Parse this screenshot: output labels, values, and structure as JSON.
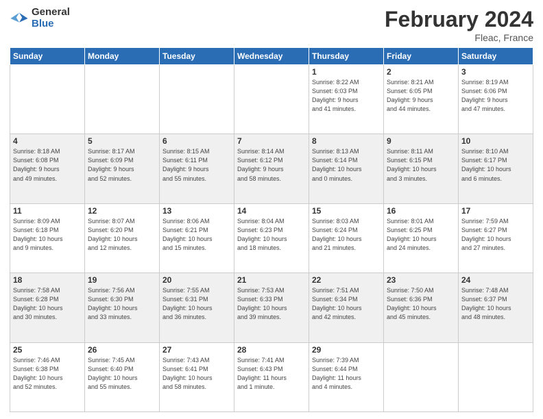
{
  "header": {
    "logo_general": "General",
    "logo_blue": "Blue",
    "title": "February 2024",
    "location": "Fleac, France"
  },
  "days_of_week": [
    "Sunday",
    "Monday",
    "Tuesday",
    "Wednesday",
    "Thursday",
    "Friday",
    "Saturday"
  ],
  "weeks": [
    [
      {
        "num": "",
        "info": ""
      },
      {
        "num": "",
        "info": ""
      },
      {
        "num": "",
        "info": ""
      },
      {
        "num": "",
        "info": ""
      },
      {
        "num": "1",
        "info": "Sunrise: 8:22 AM\nSunset: 6:03 PM\nDaylight: 9 hours\nand 41 minutes."
      },
      {
        "num": "2",
        "info": "Sunrise: 8:21 AM\nSunset: 6:05 PM\nDaylight: 9 hours\nand 44 minutes."
      },
      {
        "num": "3",
        "info": "Sunrise: 8:19 AM\nSunset: 6:06 PM\nDaylight: 9 hours\nand 47 minutes."
      }
    ],
    [
      {
        "num": "4",
        "info": "Sunrise: 8:18 AM\nSunset: 6:08 PM\nDaylight: 9 hours\nand 49 minutes."
      },
      {
        "num": "5",
        "info": "Sunrise: 8:17 AM\nSunset: 6:09 PM\nDaylight: 9 hours\nand 52 minutes."
      },
      {
        "num": "6",
        "info": "Sunrise: 8:15 AM\nSunset: 6:11 PM\nDaylight: 9 hours\nand 55 minutes."
      },
      {
        "num": "7",
        "info": "Sunrise: 8:14 AM\nSunset: 6:12 PM\nDaylight: 9 hours\nand 58 minutes."
      },
      {
        "num": "8",
        "info": "Sunrise: 8:13 AM\nSunset: 6:14 PM\nDaylight: 10 hours\nand 0 minutes."
      },
      {
        "num": "9",
        "info": "Sunrise: 8:11 AM\nSunset: 6:15 PM\nDaylight: 10 hours\nand 3 minutes."
      },
      {
        "num": "10",
        "info": "Sunrise: 8:10 AM\nSunset: 6:17 PM\nDaylight: 10 hours\nand 6 minutes."
      }
    ],
    [
      {
        "num": "11",
        "info": "Sunrise: 8:09 AM\nSunset: 6:18 PM\nDaylight: 10 hours\nand 9 minutes."
      },
      {
        "num": "12",
        "info": "Sunrise: 8:07 AM\nSunset: 6:20 PM\nDaylight: 10 hours\nand 12 minutes."
      },
      {
        "num": "13",
        "info": "Sunrise: 8:06 AM\nSunset: 6:21 PM\nDaylight: 10 hours\nand 15 minutes."
      },
      {
        "num": "14",
        "info": "Sunrise: 8:04 AM\nSunset: 6:23 PM\nDaylight: 10 hours\nand 18 minutes."
      },
      {
        "num": "15",
        "info": "Sunrise: 8:03 AM\nSunset: 6:24 PM\nDaylight: 10 hours\nand 21 minutes."
      },
      {
        "num": "16",
        "info": "Sunrise: 8:01 AM\nSunset: 6:25 PM\nDaylight: 10 hours\nand 24 minutes."
      },
      {
        "num": "17",
        "info": "Sunrise: 7:59 AM\nSunset: 6:27 PM\nDaylight: 10 hours\nand 27 minutes."
      }
    ],
    [
      {
        "num": "18",
        "info": "Sunrise: 7:58 AM\nSunset: 6:28 PM\nDaylight: 10 hours\nand 30 minutes."
      },
      {
        "num": "19",
        "info": "Sunrise: 7:56 AM\nSunset: 6:30 PM\nDaylight: 10 hours\nand 33 minutes."
      },
      {
        "num": "20",
        "info": "Sunrise: 7:55 AM\nSunset: 6:31 PM\nDaylight: 10 hours\nand 36 minutes."
      },
      {
        "num": "21",
        "info": "Sunrise: 7:53 AM\nSunset: 6:33 PM\nDaylight: 10 hours\nand 39 minutes."
      },
      {
        "num": "22",
        "info": "Sunrise: 7:51 AM\nSunset: 6:34 PM\nDaylight: 10 hours\nand 42 minutes."
      },
      {
        "num": "23",
        "info": "Sunrise: 7:50 AM\nSunset: 6:36 PM\nDaylight: 10 hours\nand 45 minutes."
      },
      {
        "num": "24",
        "info": "Sunrise: 7:48 AM\nSunset: 6:37 PM\nDaylight: 10 hours\nand 48 minutes."
      }
    ],
    [
      {
        "num": "25",
        "info": "Sunrise: 7:46 AM\nSunset: 6:38 PM\nDaylight: 10 hours\nand 52 minutes."
      },
      {
        "num": "26",
        "info": "Sunrise: 7:45 AM\nSunset: 6:40 PM\nDaylight: 10 hours\nand 55 minutes."
      },
      {
        "num": "27",
        "info": "Sunrise: 7:43 AM\nSunset: 6:41 PM\nDaylight: 10 hours\nand 58 minutes."
      },
      {
        "num": "28",
        "info": "Sunrise: 7:41 AM\nSunset: 6:43 PM\nDaylight: 11 hours\nand 1 minute."
      },
      {
        "num": "29",
        "info": "Sunrise: 7:39 AM\nSunset: 6:44 PM\nDaylight: 11 hours\nand 4 minutes."
      },
      {
        "num": "",
        "info": ""
      },
      {
        "num": "",
        "info": ""
      }
    ]
  ]
}
